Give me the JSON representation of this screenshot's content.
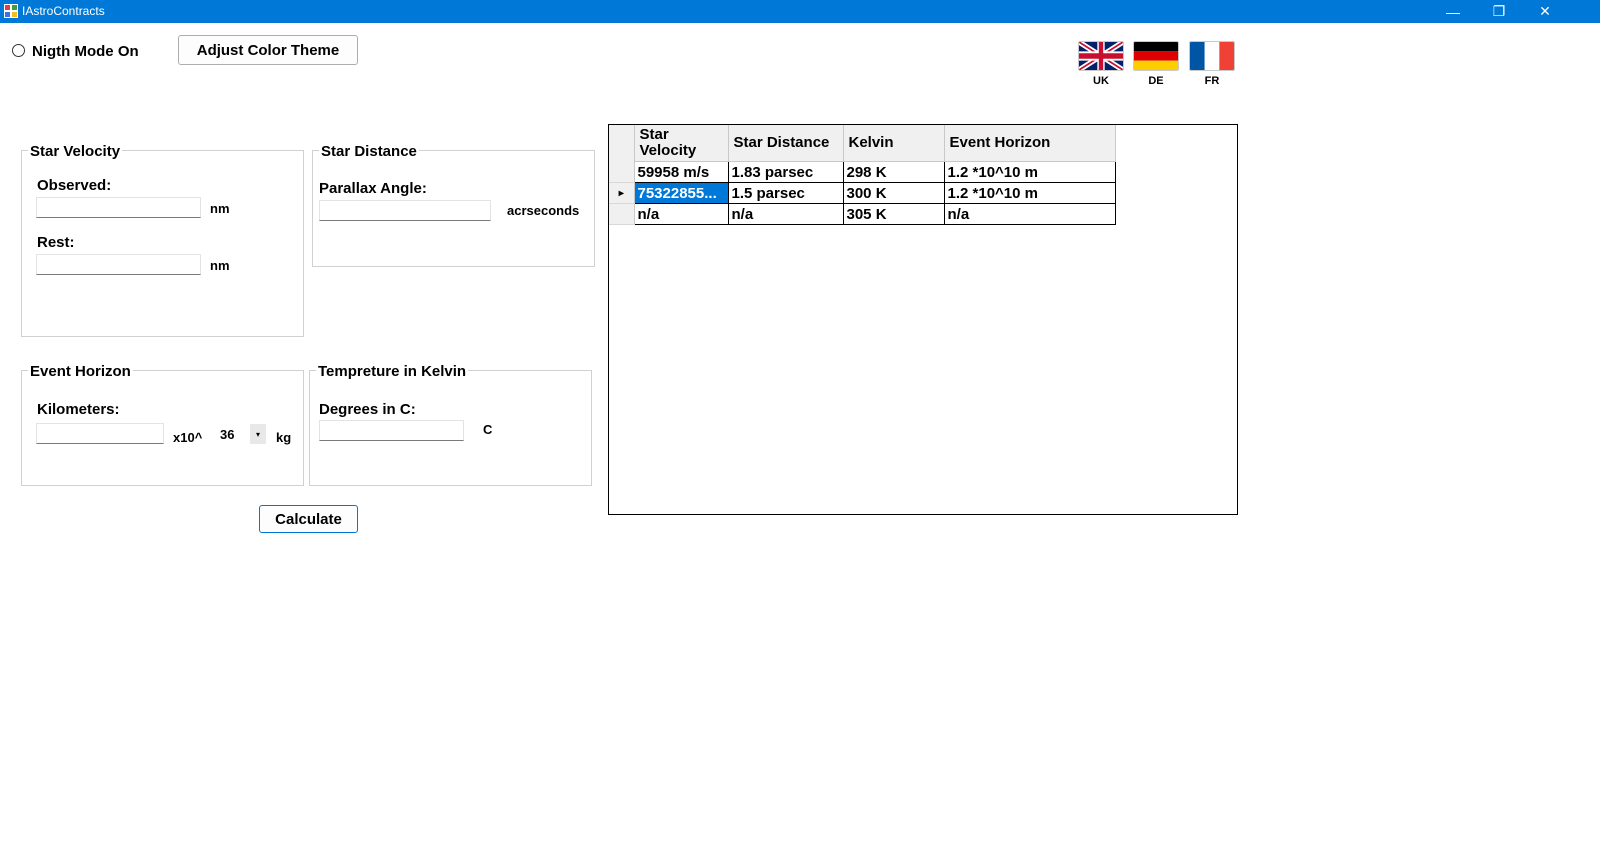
{
  "window": {
    "title": "IAstroContracts",
    "minimize": "—",
    "restore": "❐",
    "close": "✕"
  },
  "toolbar": {
    "night_mode_label": "Nigth Mode On",
    "night_mode_checked": false,
    "color_theme_button": "Adjust Color Theme"
  },
  "languages": [
    {
      "code": "UK"
    },
    {
      "code": "DE"
    },
    {
      "code": "FR"
    }
  ],
  "star_velocity": {
    "title": "Star Velocity",
    "observed_label": "Observed:",
    "observed_value": "",
    "observed_unit": "nm",
    "rest_label": "Rest:",
    "rest_value": "",
    "rest_unit": "nm"
  },
  "star_distance": {
    "title": "Star Distance",
    "parallax_label": "Parallax Angle:",
    "parallax_value": "",
    "parallax_unit": "acrseconds"
  },
  "event_horizon": {
    "title": "Event Horizon",
    "km_label": "Kilometers:",
    "km_value": "",
    "multiplier": "x10^",
    "exponent": "36",
    "unit": "kg"
  },
  "temperature": {
    "title": "Tempreture in Kelvin",
    "degrees_label": "Degrees in C:",
    "degrees_value": "",
    "unit": "C"
  },
  "calculate_button": "Calculate",
  "grid": {
    "columns": [
      "Star Velocity",
      "Star Distance",
      "Kelvin",
      "Event Horizon"
    ],
    "rows": [
      [
        "59958 m/s",
        "1.83 parsec",
        "298 K",
        "1.2 *10^10 m"
      ],
      [
        "75322855...",
        "1.5 parsec",
        "300 K",
        "1.2 *10^10 m"
      ],
      [
        "n/a",
        "n/a",
        "305 K",
        "n/a"
      ]
    ],
    "current_row_marker": "▸",
    "selected_row": 1
  },
  "colors": {
    "titlebar": "#0078d7",
    "selection": "#0078d7"
  }
}
